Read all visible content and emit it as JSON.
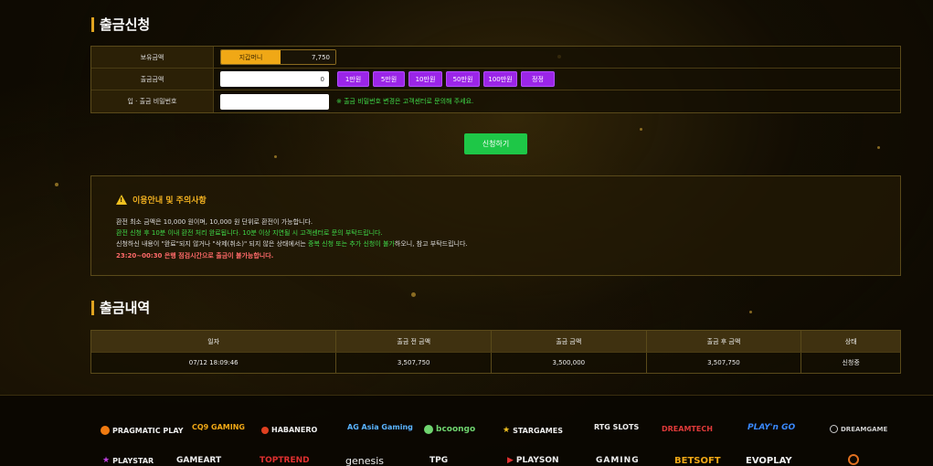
{
  "withdraw_title": "출금신청",
  "form": {
    "balance_label": "보유금액",
    "balance_tag": "지갑머니",
    "balance_value": "7,750",
    "amount_label": "출금금액",
    "amount_value": "0",
    "amount_buttons": [
      "1만원",
      "5만원",
      "10만원",
      "50만원",
      "100만원",
      "정정"
    ],
    "password_label": "입 · 출금 비밀번호",
    "password_value": "",
    "password_note": "※ 출금 비밀번호 변경은 고객센터로 문의해 주세요."
  },
  "submit_label": "신청하기",
  "notice": {
    "title": "이용안내 및 주의사항",
    "line1": "환전 최소 금액은 10,000 원이며, 10,000 원 단위로 환전이 가능합니다.",
    "line2": "환전 신청 후 10분 이내 환전 처리 완료됩니다. 10분 이상 지연될 시 고객센터로 문의 부탁드립니다.",
    "line3_a": "신청하신 내용이 \"완료\"되지 않거나 \"삭제(취소)\" 되지 않은 상태",
    "line3_b": "에서는 ",
    "line3_c": "중복 신청 또는 추가 신청이 불가",
    "line3_d": "하오니, 참고 부탁드립니다.",
    "line4": "23:20~00:30 은행 점검시간으로 출금이 불가능합니다."
  },
  "history_title": "출금내역",
  "history": {
    "columns": [
      "일자",
      "출금 전 금액",
      "출금 금액",
      "출금 후 금액",
      "상태"
    ],
    "rows": [
      [
        "07/12 18:09:46",
        "3,507,750",
        "3,500,000",
        "3,507,750",
        "신청중"
      ]
    ]
  },
  "providers_row1": [
    "PRAGMATIC PLAY",
    "CQ9 GAMING",
    "HABANERO",
    "AG Asia Gaming",
    "bcoongo",
    "STARGAMES",
    "RTG SLOTS",
    "DREAMTECH",
    "PLAY'n GO",
    "DREAMGAME"
  ],
  "providers_row2": [
    "PLAYSTAR",
    "GAMEART",
    "TOPTREND",
    "genesis",
    "TPG",
    "PLAYSON",
    "GAMING",
    "BETSOFT",
    "EVOPLAY"
  ],
  "colors": {
    "accent": "#f0a816",
    "purple": "#9b25e8",
    "green": "#1ec747",
    "note_green": "#3fdb49",
    "warn_red": "#ff6a6a"
  }
}
